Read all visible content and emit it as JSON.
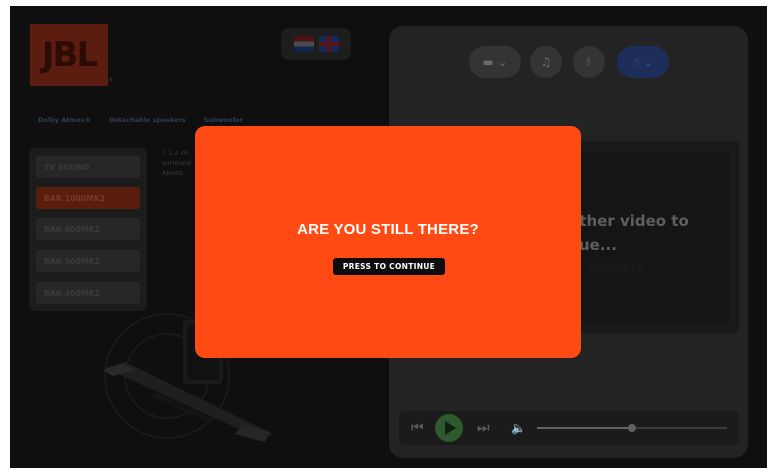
{
  "brand": {
    "logo_text": "JBL",
    "registered": "®"
  },
  "languages": [
    {
      "icon": "flag-nl-icon"
    },
    {
      "icon": "flag-gb-icon"
    }
  ],
  "features": {
    "tabs": [
      "Dolby Atmos®",
      "Detachable speakers",
      "Subwoofer"
    ]
  },
  "models": {
    "items": [
      "TV SOUND",
      "BAR 1000MK2",
      "BAR 800MK2",
      "BAR 500MK2",
      "BAR 300MK2"
    ],
    "active_index": 1,
    "description": "7.1.4 ch surround Atmos"
  },
  "sources": {
    "active": "bluetooth-settings"
  },
  "video": {
    "line1": "other video to",
    "line2": "ue...",
    "sub": "SECONDEN"
  },
  "player": {
    "volume_percent": 50
  },
  "modal": {
    "title": "ARE YOU STILL THERE?",
    "button_label": "PRESS TO CONTINUE"
  },
  "colors": {
    "accent": "#ff4a14",
    "background": "#0f0f0f"
  }
}
